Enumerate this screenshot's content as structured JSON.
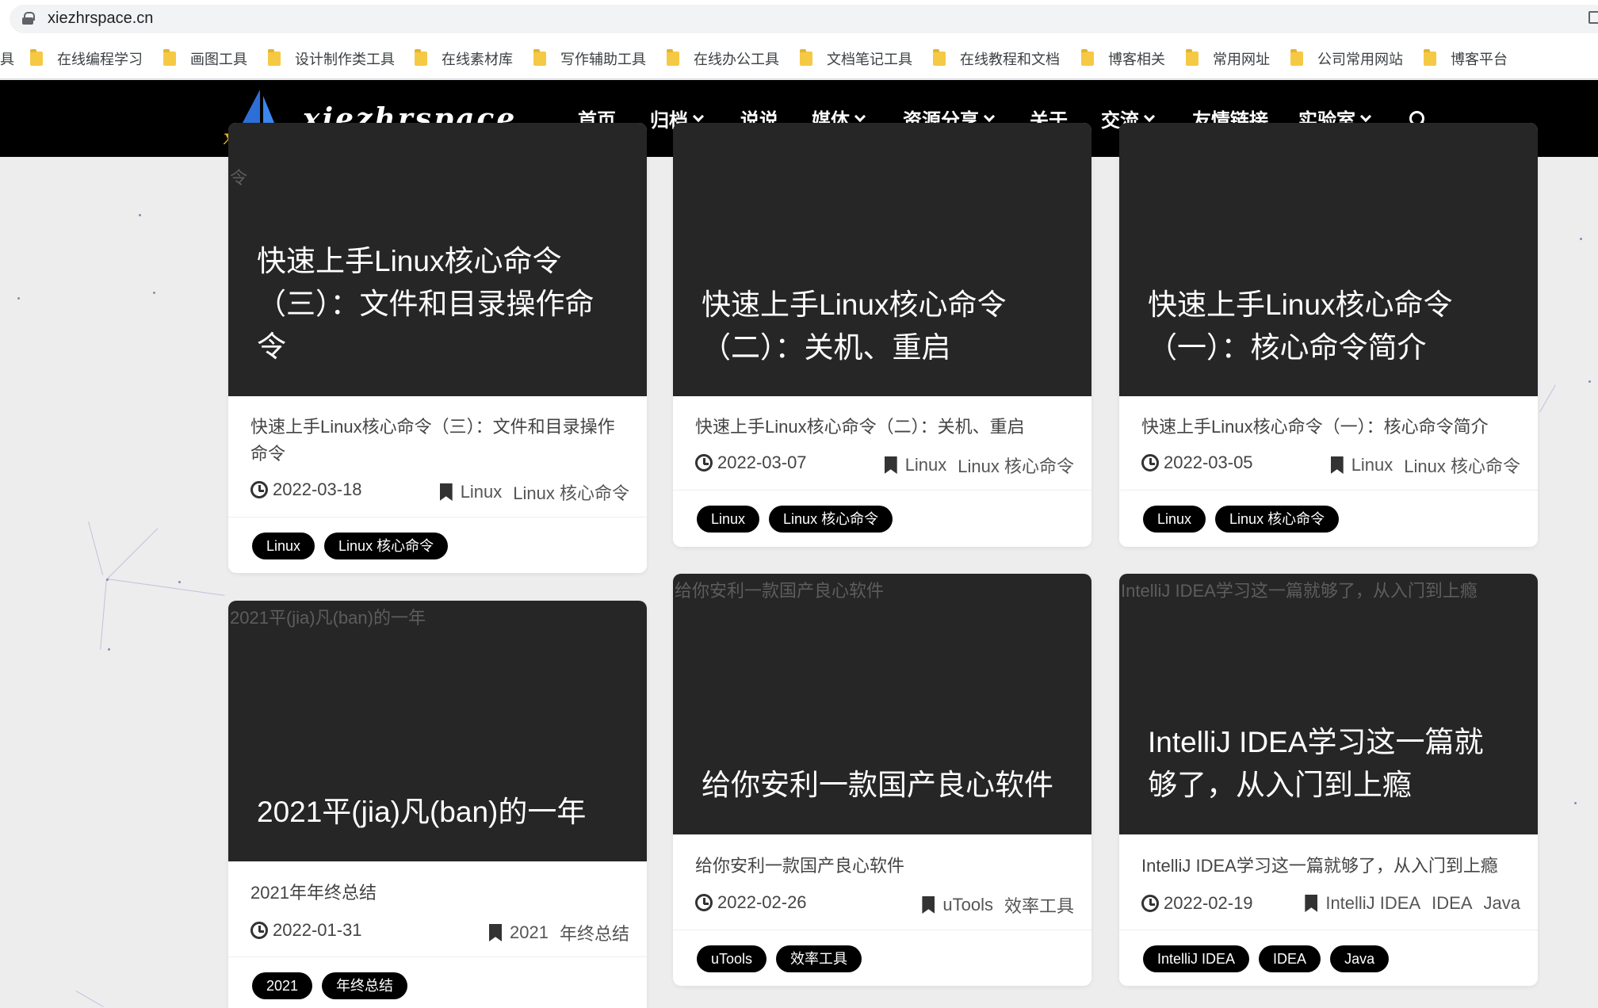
{
  "browser": {
    "url": "xiezhrspace.cn",
    "bookmarks": [
      {
        "label": "具"
      },
      {
        "label": "在线编程学习"
      },
      {
        "label": "画图工具"
      },
      {
        "label": "设计制作类工具"
      },
      {
        "label": "在线素材库"
      },
      {
        "label": "写作辅助工具"
      },
      {
        "label": "在线办公工具"
      },
      {
        "label": "文档笔记工具"
      },
      {
        "label": "在线教程和文档"
      },
      {
        "label": "博客相关"
      },
      {
        "label": "常用网址"
      },
      {
        "label": "公司常用网站"
      },
      {
        "label": "博客平台"
      }
    ]
  },
  "site": {
    "logo_text": "xiezhr",
    "brand": "xiezhrspace",
    "nav": [
      {
        "label": "首页",
        "dropdown": false
      },
      {
        "label": "归档",
        "dropdown": true
      },
      {
        "label": "说说",
        "dropdown": false
      },
      {
        "label": "媒体",
        "dropdown": true
      },
      {
        "label": "资源分享",
        "dropdown": true
      },
      {
        "label": "关于",
        "dropdown": false
      },
      {
        "label": "交流",
        "dropdown": true
      },
      {
        "label": "友情链接",
        "dropdown": false
      },
      {
        "label": "实验室",
        "dropdown": true
      }
    ]
  },
  "posts": [
    {
      "image_alt": "令",
      "thumb_title": "快速上手Linux核心命令（三）：文件和目录操作命令",
      "title": "快速上手Linux核心命令（三）：文件和目录操作命令",
      "date": "2022-03-18",
      "categories": [
        "Linux",
        "Linux 核心命令"
      ],
      "tags": [
        "Linux",
        "Linux 核心命令"
      ]
    },
    {
      "image_alt": "",
      "thumb_title": "快速上手Linux核心命令（二）：关机、重启",
      "title": "快速上手Linux核心命令（二）：关机、重启",
      "date": "2022-03-07",
      "categories": [
        "Linux",
        "Linux 核心命令"
      ],
      "tags": [
        "Linux",
        "Linux 核心命令"
      ]
    },
    {
      "image_alt": "",
      "thumb_title": "快速上手Linux核心命令（一）：核心命令简介",
      "title": "快速上手Linux核心命令（一）：核心命令简介",
      "date": "2022-03-05",
      "categories": [
        "Linux",
        "Linux 核心命令"
      ],
      "tags": [
        "Linux",
        "Linux 核心命令"
      ]
    },
    {
      "image_alt": "2021平(jia)凡(ban)的一年",
      "thumb_title": "2021平(jia)凡(ban)的一年",
      "title": "2021年年终总结",
      "date": "2022-01-31",
      "categories": [
        "2021",
        "年终总结"
      ],
      "tags": [
        "2021",
        "年终总结"
      ]
    },
    {
      "image_alt": "给你安利一款国产良心软件",
      "thumb_title": "给你安利一款国产良心软件",
      "title": "给你安利一款国产良心软件",
      "date": "2022-02-26",
      "categories": [
        "uTools",
        "效率工具"
      ],
      "tags": [
        "uTools",
        "效率工具"
      ]
    },
    {
      "image_alt": "IntelliJ IDEA学习这一篇就够了，从入门到上瘾",
      "thumb_title": "IntelliJ IDEA学习这一篇就够了，从入门到上瘾",
      "title": "IntelliJ IDEA学习这一篇就够了，从入门到上瘾",
      "date": "2022-02-19",
      "categories": [
        "IntelliJ IDEA",
        "IDEA",
        "Java"
      ],
      "tags": [
        "IntelliJ IDEA",
        "IDEA",
        "Java"
      ]
    }
  ]
}
